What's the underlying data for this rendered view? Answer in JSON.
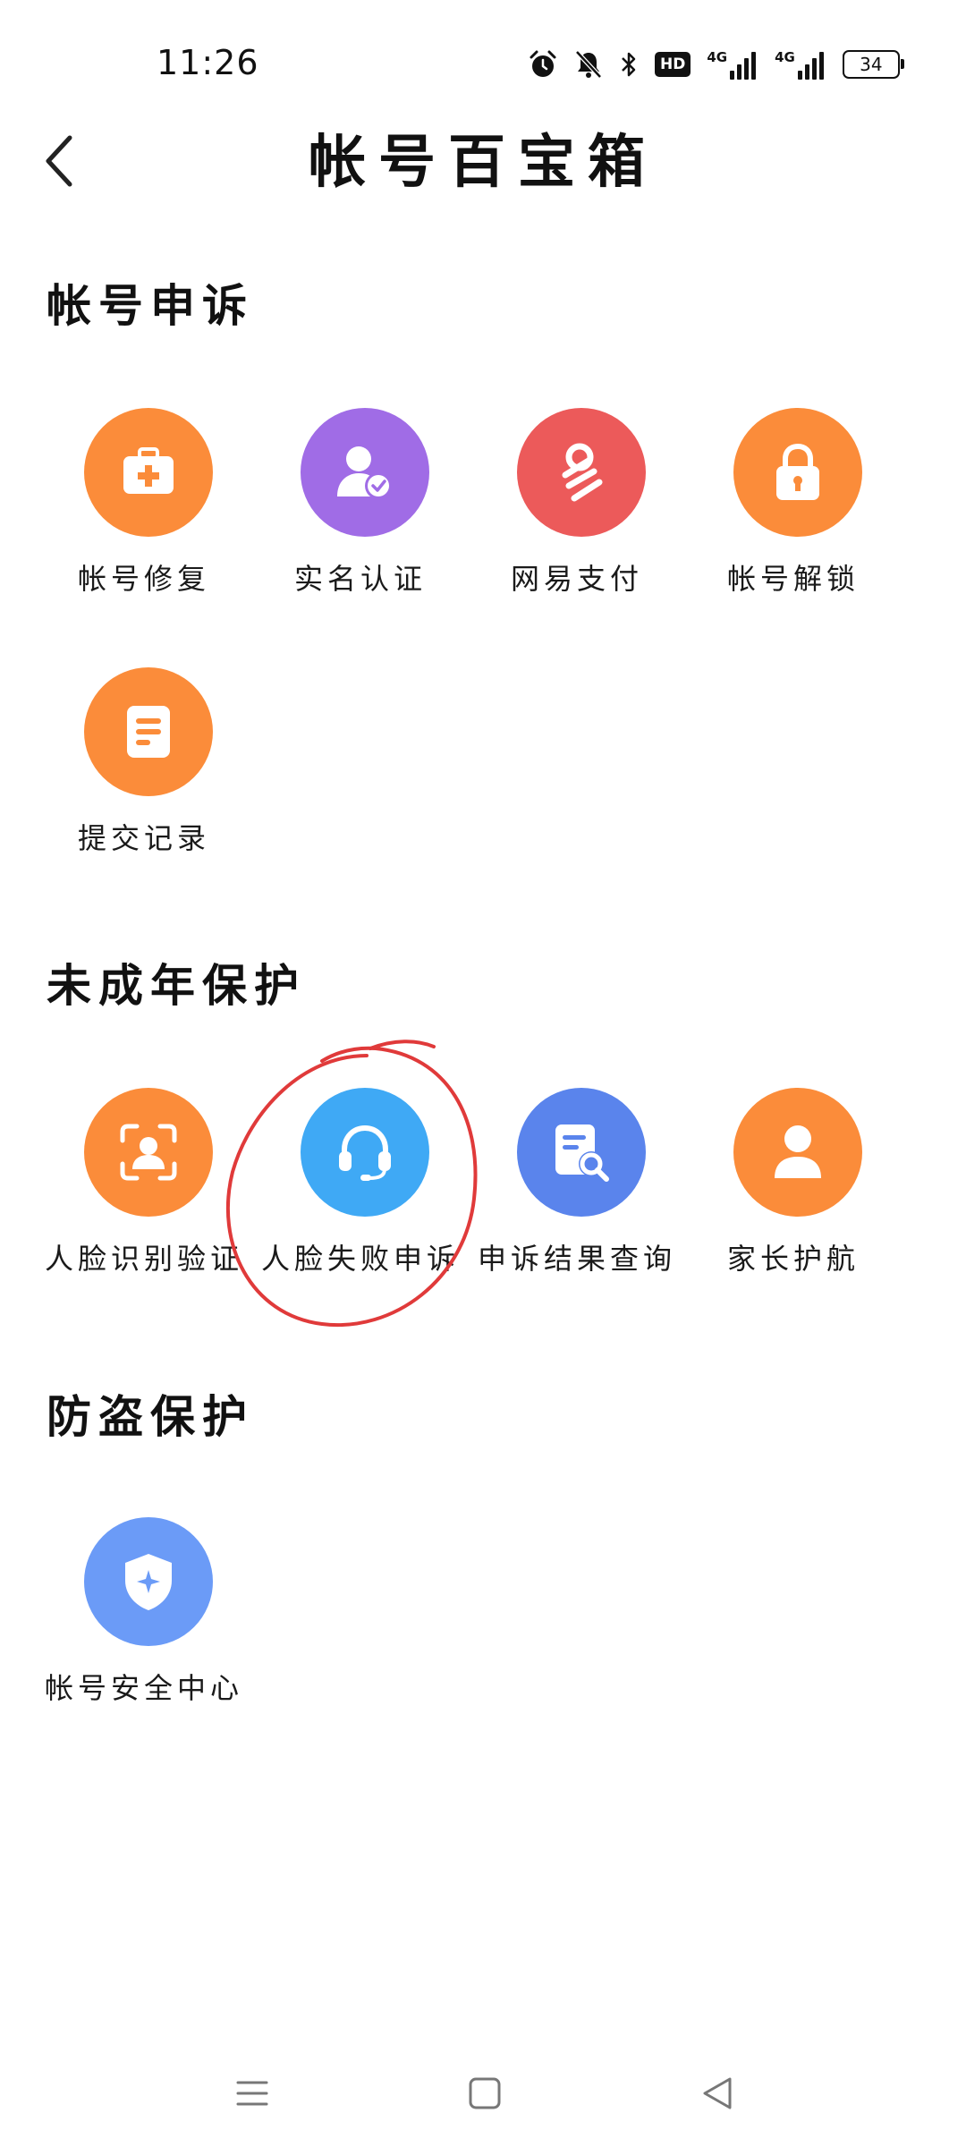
{
  "status_bar": {
    "time": "11:26",
    "hd": "HD",
    "net1": "4G",
    "net2": "4G",
    "battery": "34"
  },
  "header": {
    "title": "帐号百宝箱"
  },
  "sections": [
    {
      "title": "帐号申诉",
      "items": [
        {
          "label": "帐号修复",
          "icon": "medical-kit-icon",
          "color": "#FB8C3A"
        },
        {
          "label": "实名认证",
          "icon": "user-verified-icon",
          "color": "#A06CE6"
        },
        {
          "label": "网易支付",
          "icon": "netease-pay-icon",
          "color": "#EC5A5A"
        },
        {
          "label": "帐号解锁",
          "icon": "lock-icon",
          "color": "#FB8C3A"
        },
        {
          "label": "提交记录",
          "icon": "document-icon",
          "color": "#FB8C3A"
        }
      ]
    },
    {
      "title": "未成年保护",
      "items": [
        {
          "label": "人脸识别验证",
          "icon": "face-scan-icon",
          "color": "#FB8C3A"
        },
        {
          "label": "人脸失败申诉",
          "icon": "headset-icon",
          "color": "#3FA9F5"
        },
        {
          "label": "申诉结果查询",
          "icon": "document-search-icon",
          "color": "#5A84EC"
        },
        {
          "label": "家长护航",
          "icon": "parent-user-icon",
          "color": "#FB8C3A"
        }
      ]
    },
    {
      "title": "防盗保护",
      "items": [
        {
          "label": "帐号安全中心",
          "icon": "shield-icon",
          "color": "#6B9BF7"
        }
      ]
    }
  ],
  "annotation_color": "#E03A3A"
}
